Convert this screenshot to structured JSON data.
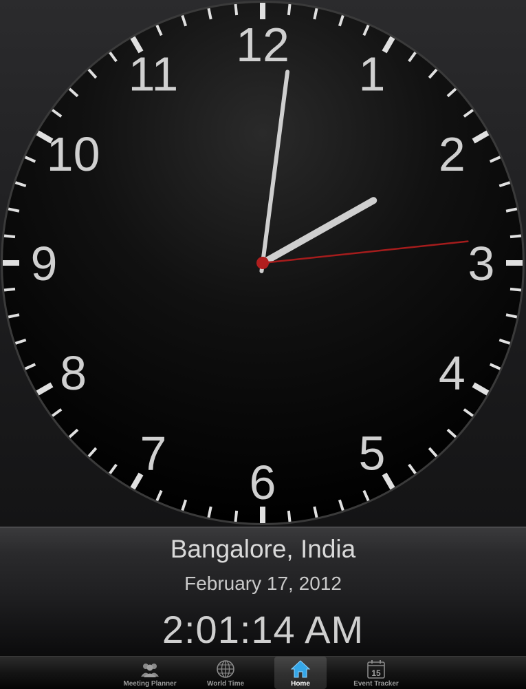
{
  "clock": {
    "numerals": [
      "12",
      "1",
      "2",
      "3",
      "4",
      "5",
      "6",
      "7",
      "8",
      "9",
      "10",
      "11"
    ],
    "hour": 2,
    "minute": 1,
    "second": 14,
    "colors": {
      "face": "#000000",
      "numerals": "#d0d0d0",
      "ticks": "#e0e0e0",
      "hands": "#cfcfcf",
      "second_hand": "#a51c1c",
      "hub": "#b01e1e"
    }
  },
  "info": {
    "city": "Bangalore, India",
    "date": "February 17, 2012",
    "time": "2:01:14 AM"
  },
  "tabs": [
    {
      "label": "Meeting Planner",
      "icon": "people-icon",
      "selected": false
    },
    {
      "label": "World Time",
      "icon": "globe-icon",
      "selected": false
    },
    {
      "label": "Home",
      "icon": "home-icon",
      "selected": true
    },
    {
      "label": "Event Tracker",
      "icon": "calendar-icon",
      "selected": false,
      "icon_text": "15"
    }
  ]
}
